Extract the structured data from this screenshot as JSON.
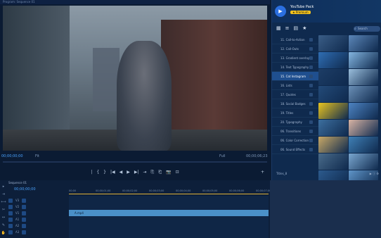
{
  "window": {
    "title": "Program: Sequence 01"
  },
  "monitor": {
    "timecode_left": "00;00;00;00",
    "fit": "Fit",
    "quality": "Full",
    "timecode_right": "00;00;06;23"
  },
  "transport": {
    "buttons": [
      "|",
      "{",
      "}",
      "|◀",
      "◀",
      "▶",
      "▶|",
      "⇥",
      "⎘",
      "⎗",
      "📷",
      "⊡"
    ],
    "add": "+"
  },
  "panel": {
    "brand": "YouTube Pack",
    "badge": "★ Premium",
    "search_placeholder": "Search",
    "tab_icons": [
      "grid-icon",
      "list-icon",
      "file-icon",
      "star-icon"
    ],
    "categories": [
      {
        "label": "11. Call-to-Action",
        "active": false
      },
      {
        "label": "12. Call-Outs",
        "active": false
      },
      {
        "label": "13. Gradient overlays",
        "active": false
      },
      {
        "label": "14. Text Typography",
        "active": false
      },
      {
        "label": "15. Cat Instagram",
        "active": true
      },
      {
        "label": "16. Lists",
        "active": false
      },
      {
        "label": "17. Quotes",
        "active": false
      },
      {
        "label": "18. Social Badges",
        "active": false
      },
      {
        "label": "19. Titles",
        "active": false
      },
      {
        "label": "20. Typography",
        "active": false
      },
      {
        "label": "06. Transitions",
        "active": false
      },
      {
        "label": "06. Color Correction",
        "active": false
      },
      {
        "label": "06. Sound Effects",
        "active": false
      }
    ],
    "thumbnail_colors": [
      "#3a5d86",
      "#5b86b8",
      "#2f6db3",
      "#83b5e0",
      "#1d3d66",
      "#9abedc",
      "#234a78",
      "#6a8fb6",
      "#e8c420",
      "#4d83c2",
      "#3c6e9e",
      "#d8b4a4",
      "#c8a866",
      "#3f7fb5",
      "#496b8a",
      "#7aa7d0",
      "#2c5a8d",
      "#5f95c9",
      "#aac9e6",
      "#3b6595"
    ],
    "footer_left": "Titles_8",
    "footer_icons": [
      "play-icon",
      "info-icon",
      "settings-icon"
    ]
  },
  "timeline": {
    "tab": "Sequence 01",
    "timecode": "00;00;00;00",
    "ruler": [
      "00;00",
      "00;00;01;00",
      "00;00;02;00",
      "00;00;03;00",
      "00;00;04;00",
      "00;00;05;00",
      "00;00;06;00",
      "00;00;07;00"
    ],
    "tracks": [
      "V3",
      "V2",
      "V1",
      "A1",
      "A2",
      "A3"
    ],
    "clip_label": "A.mp4"
  }
}
